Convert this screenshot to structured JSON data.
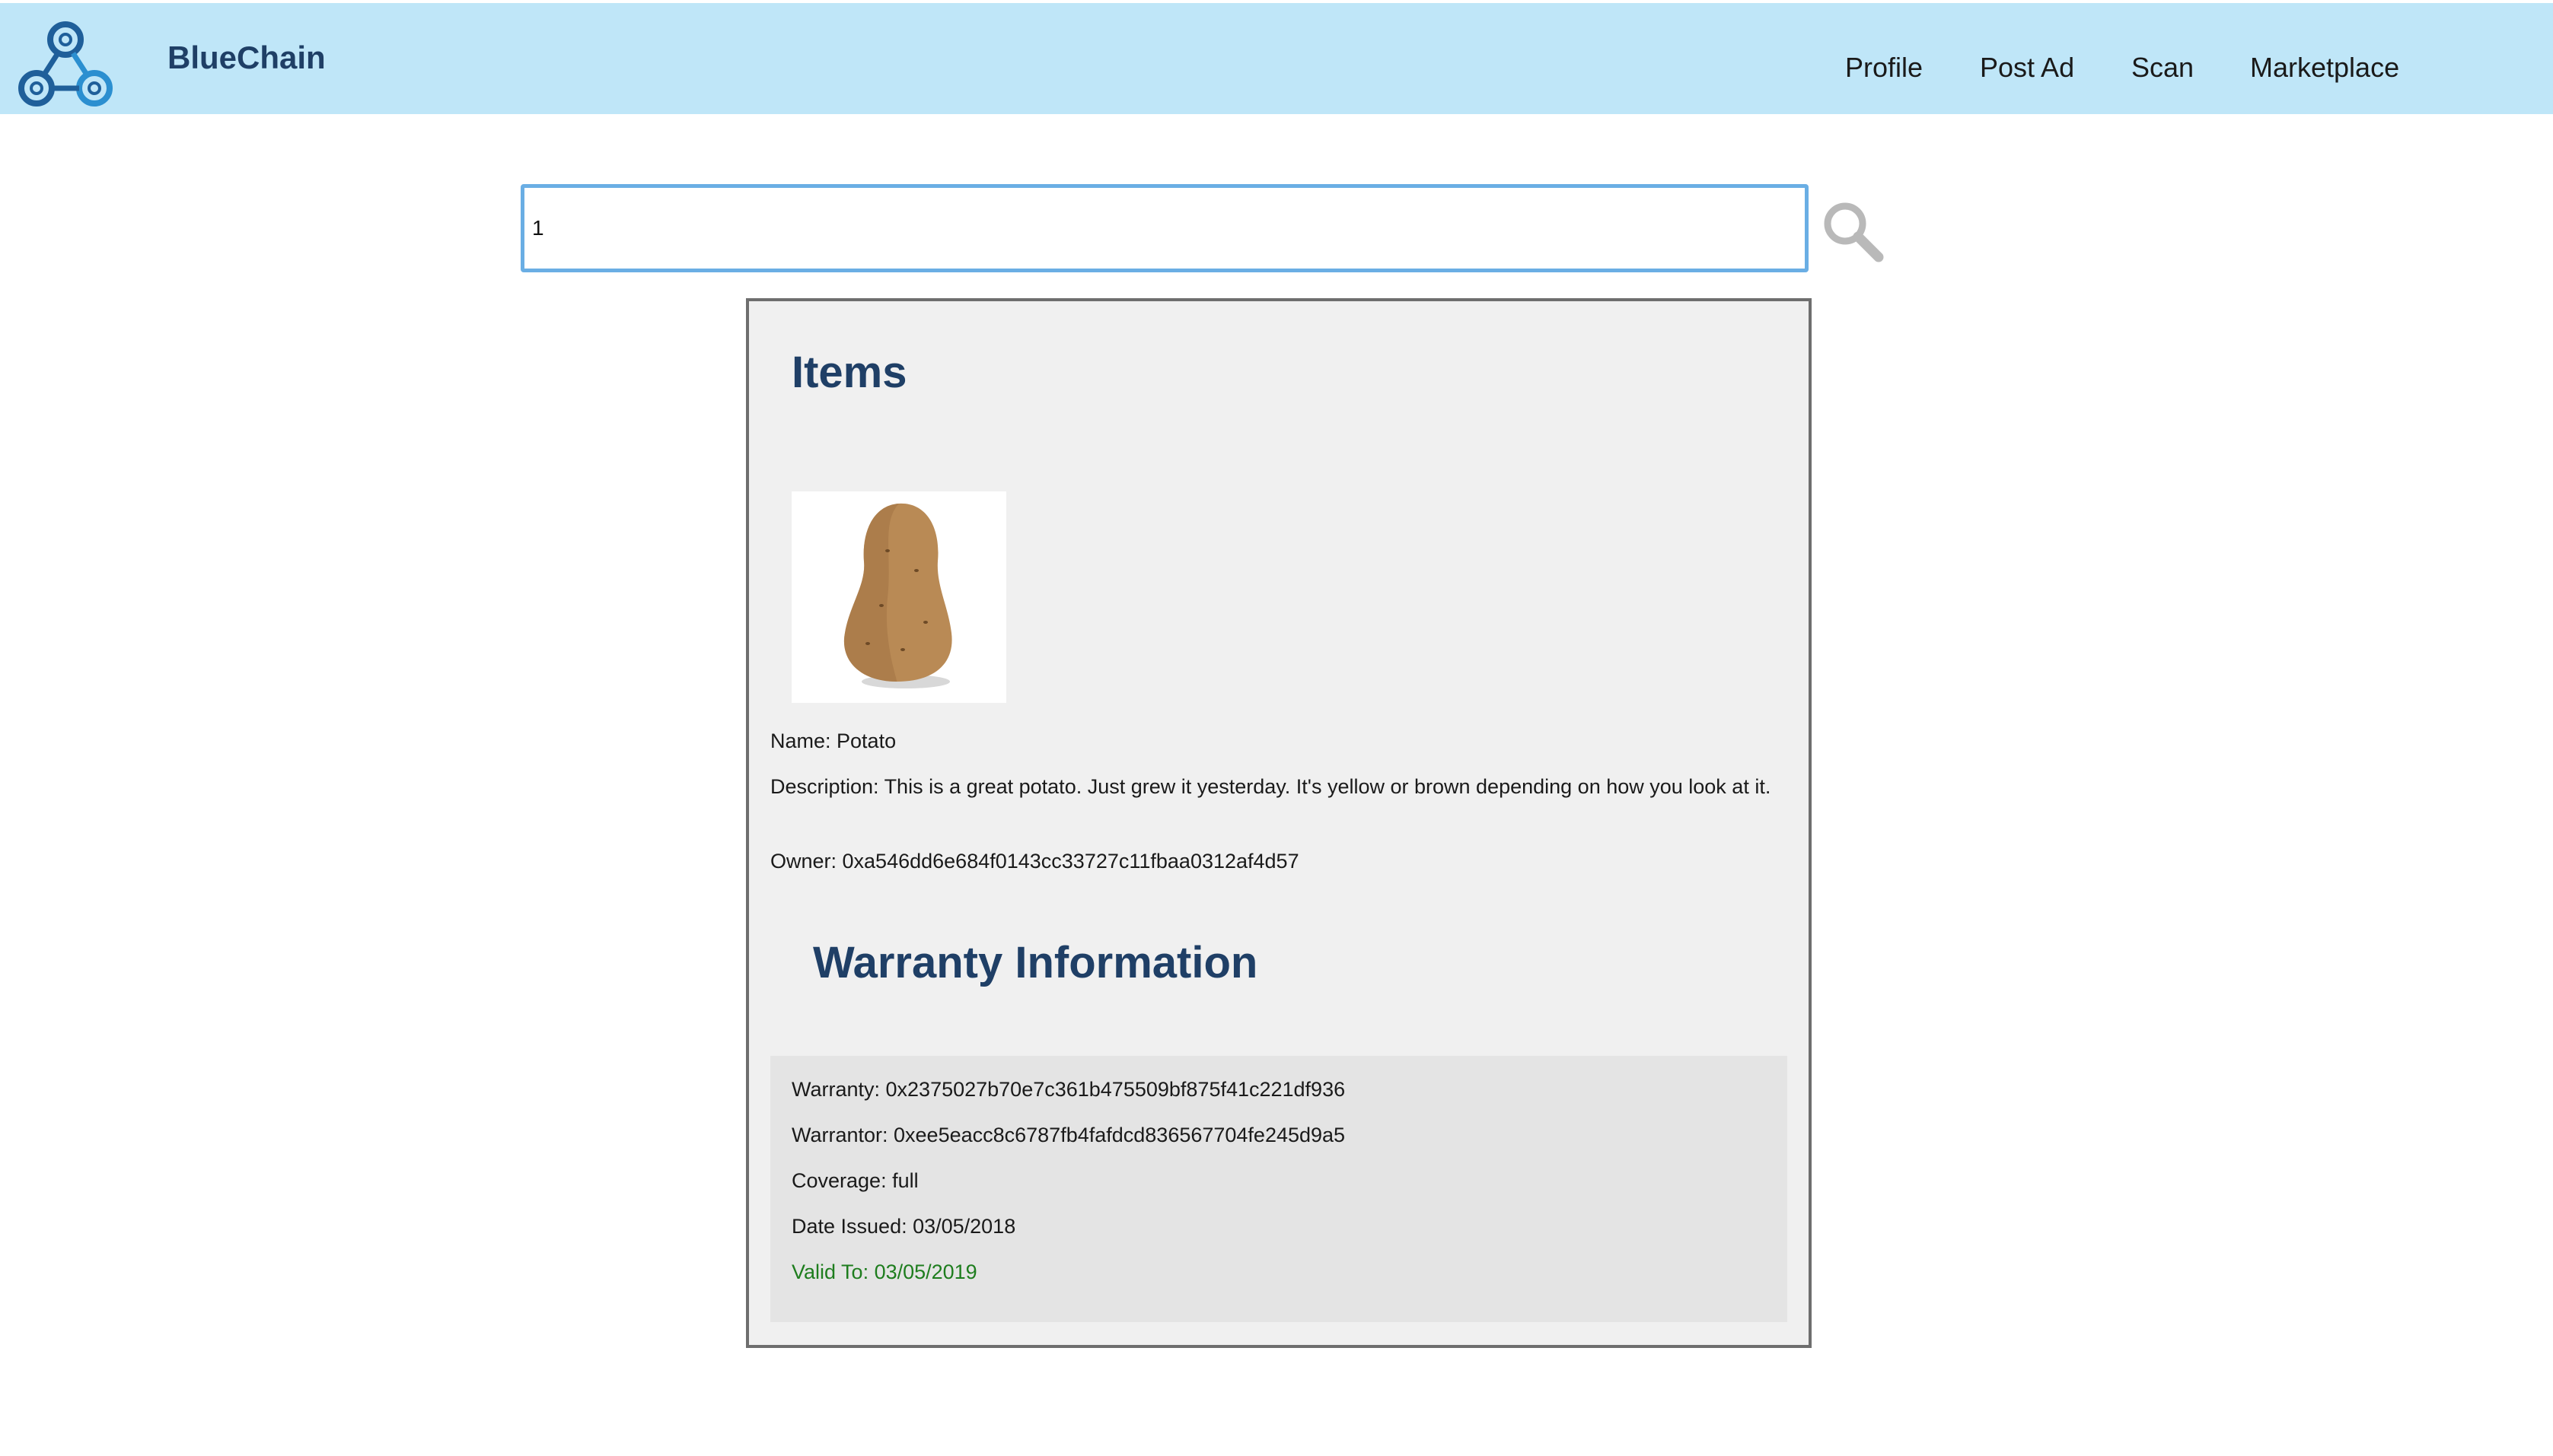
{
  "header": {
    "brand": "BlueChain",
    "nav": {
      "profile": "Profile",
      "post_ad": "Post Ad",
      "scan": "Scan",
      "marketplace": "Marketplace"
    },
    "colors": {
      "bar": "#bfe6f8",
      "brand": "#1f3f66"
    }
  },
  "search": {
    "value": "1",
    "icon": "search-icon"
  },
  "items": {
    "heading": "Items",
    "image": "potato-photo",
    "name": "Name: Potato",
    "description": "Description: This is a great potato. Just grew it yesterday. It's yellow or brown depending on how you look at it.",
    "owner": "Owner: 0xa546dd6e684f0143cc33727c11fbaa0312af4d57"
  },
  "warranty": {
    "heading": "Warranty Information",
    "warranty": "Warranty: 0x2375027b70e7c361b475509bf875f41c221df936",
    "warrantor": "Warrantor: 0xee5eacc8c6787fb4fafdcd836567704fe245d9a5",
    "coverage": "Coverage: full",
    "date_issued": "Date Issued: 03/05/2018",
    "valid_to": "Valid To: 03/05/2019",
    "valid_color": "#1e7d1e"
  }
}
